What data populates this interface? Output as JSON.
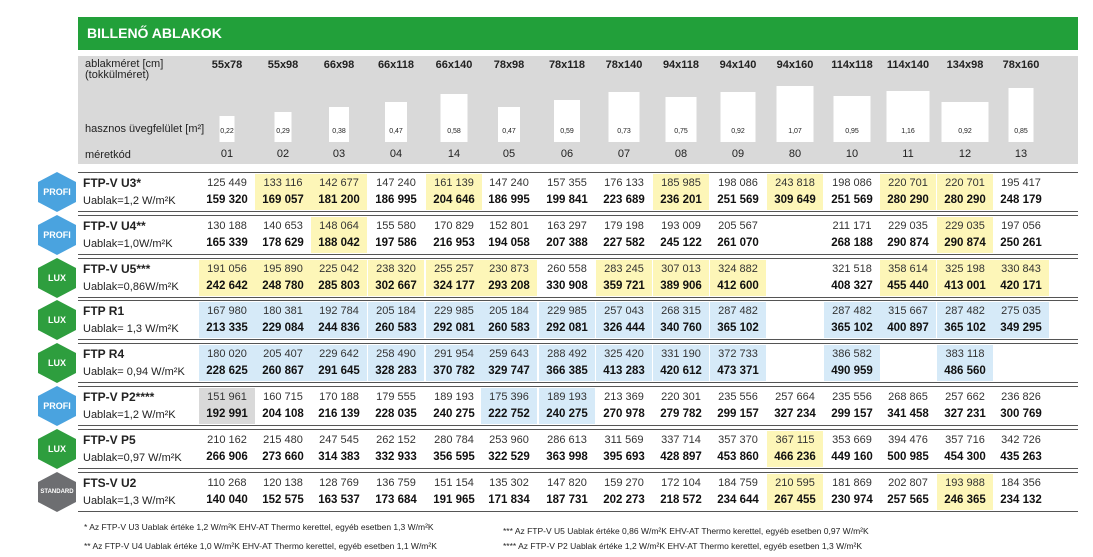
{
  "title": "BILLENŐ ABLAKOK",
  "header": {
    "size_label": "ablakméret [cm]\n(tokkülméret)",
    "area_label": "hasznos üvegfelület [m²]",
    "code_label": "méretkód",
    "columns": [
      {
        "size": "55x78",
        "area": "0,22",
        "code": "01"
      },
      {
        "size": "55x98",
        "area": "0,29",
        "code": "02"
      },
      {
        "size": "66x98",
        "area": "0,38",
        "code": "03"
      },
      {
        "size": "66x118",
        "area": "0,47",
        "code": "04"
      },
      {
        "size": "66x140",
        "area": "0,58",
        "code": "14"
      },
      {
        "size": "78x98",
        "area": "0,47",
        "code": "05"
      },
      {
        "size": "78x118",
        "area": "0,59",
        "code": "06"
      },
      {
        "size": "78x140",
        "area": "0,73",
        "code": "07"
      },
      {
        "size": "94x118",
        "area": "0,75",
        "code": "08"
      },
      {
        "size": "94x140",
        "area": "0,92",
        "code": "09"
      },
      {
        "size": "94x160",
        "area": "1,07",
        "code": "80"
      },
      {
        "size": "114x118",
        "area": "0,95",
        "code": "10"
      },
      {
        "size": "114x140",
        "area": "1,16",
        "code": "11"
      },
      {
        "size": "134x98",
        "area": "0,92",
        "code": "12"
      },
      {
        "size": "78x160",
        "area": "0,85",
        "code": "13"
      }
    ]
  },
  "rows": [
    {
      "badge": "PROFI",
      "badge_color": "#4aa3df",
      "name": "FTP-V U3*",
      "u": "Uablak=1,2 W/m²K",
      "p1": [
        "125 449",
        "133 116",
        "142 677",
        "147 240",
        "161 139",
        "147 240",
        "157 355",
        "176 133",
        "185 985",
        "198 086",
        "243 818",
        "198 086",
        "220 701",
        "220 701",
        "195 417"
      ],
      "p2": [
        "159 320",
        "169 057",
        "181 200",
        "186 995",
        "204 646",
        "186 995",
        "199 841",
        "223 689",
        "236 201",
        "251 569",
        "309 649",
        "251 569",
        "280 290",
        "280 290",
        "248 179"
      ]
    },
    {
      "badge": "PROFI",
      "badge_color": "#4aa3df",
      "name": "FTP-V U4**",
      "u": "Uablak=1,0W/m²K",
      "p1": [
        "130 188",
        "140 653",
        "148 064",
        "155 580",
        "170 829",
        "152 801",
        "163 297",
        "179 198",
        "193 009",
        "205 567",
        "",
        "211 171",
        "229 035",
        "229 035",
        "197 056"
      ],
      "p2": [
        "165 339",
        "178 629",
        "188 042",
        "197 586",
        "216 953",
        "194 058",
        "207 388",
        "227 582",
        "245 122",
        "261 070",
        "",
        "268 188",
        "290 874",
        "290 874",
        "250 261"
      ]
    },
    {
      "badge": "LUX",
      "badge_color": "#2e9e3e",
      "name": "FTP-V U5***",
      "u": "Uablak=0,86W/m²K",
      "p1": [
        "191 056",
        "195 890",
        "225 042",
        "238 320",
        "255 257",
        "230 873",
        "260 558",
        "283 245",
        "307 013",
        "324 882",
        "",
        "321 518",
        "358 614",
        "325 198",
        "330 843"
      ],
      "p2": [
        "242 642",
        "248 780",
        "285 803",
        "302 667",
        "324 177",
        "293 208",
        "330 908",
        "359 721",
        "389 906",
        "412 600",
        "",
        "408 327",
        "455 440",
        "413 001",
        "420 171"
      ]
    },
    {
      "badge": "LUX",
      "badge_color": "#2e9e3e",
      "name": "FTP R1",
      "u": "Uablak= 1,3 W/m²K",
      "p1": [
        "167 980",
        "180 381",
        "192 784",
        "205 184",
        "229 985",
        "205 184",
        "229 985",
        "257 043",
        "268 315",
        "287 482",
        "",
        "287 482",
        "315 667",
        "287 482",
        "275 035"
      ],
      "p2": [
        "213 335",
        "229 084",
        "244 836",
        "260 583",
        "292 081",
        "260 583",
        "292 081",
        "326 444",
        "340 760",
        "365 102",
        "",
        "365 102",
        "400 897",
        "365 102",
        "349 295"
      ]
    },
    {
      "badge": "LUX",
      "badge_color": "#2e9e3e",
      "name": "FTP R4",
      "u": "Uablak= 0,94 W/m²K",
      "p1": [
        "180 020",
        "205 407",
        "229 642",
        "258 490",
        "291 954",
        "259 643",
        "288 492",
        "325 420",
        "331 190",
        "372 733",
        "",
        "386 582",
        "",
        "383 118",
        ""
      ],
      "p2": [
        "228 625",
        "260 867",
        "291 645",
        "328 283",
        "370 782",
        "329 747",
        "366 385",
        "413 283",
        "420 612",
        "473 371",
        "",
        "490 959",
        "",
        "486 560",
        ""
      ]
    },
    {
      "badge": "PROFI",
      "badge_color": "#4aa3df",
      "name": "FTP-V P2****",
      "u": "Uablak=1,2 W/m²K",
      "p1": [
        "151 961",
        "160 715",
        "170 188",
        "179 555",
        "189 193",
        "175 396",
        "189 193",
        "213 369",
        "220 301",
        "235 556",
        "257 664",
        "235 556",
        "268 865",
        "257 662",
        "236 826"
      ],
      "p2": [
        "192 991",
        "204 108",
        "216 139",
        "228 035",
        "240 275",
        "222 752",
        "240 275",
        "270 978",
        "279 782",
        "299 157",
        "327 234",
        "299 157",
        "341 458",
        "327 231",
        "300 769"
      ]
    },
    {
      "badge": "LUX",
      "badge_color": "#2e9e3e",
      "name": "FTP-V P5",
      "u": "Uablak=0,97 W/m²K",
      "p1": [
        "210 162",
        "215 480",
        "247 545",
        "262 152",
        "280 784",
        "253 960",
        "286 613",
        "311 569",
        "337 714",
        "357 370",
        "367 115",
        "353 669",
        "394 476",
        "357 716",
        "342 726"
      ],
      "p2": [
        "266 906",
        "273 660",
        "314 383",
        "332 933",
        "356 595",
        "322 529",
        "363 998",
        "395 693",
        "428 897",
        "453 860",
        "466 236",
        "449 160",
        "500 985",
        "454 300",
        "435 263"
      ]
    },
    {
      "badge": "STANDARD",
      "badge_color": "#6d6e71",
      "name": "FTS-V U2",
      "u": "Uablak=1,3 W/m²K",
      "p1": [
        "110 268",
        "120 138",
        "128 769",
        "136 759",
        "151 154",
        "135 302",
        "147 820",
        "159 270",
        "172 104",
        "184 759",
        "210 595",
        "181 869",
        "202 807",
        "193 988",
        "184 356"
      ],
      "p2": [
        "140 040",
        "152 575",
        "163 537",
        "173 684",
        "191 965",
        "171 834",
        "187 731",
        "202 273",
        "218 572",
        "234 644",
        "267 455",
        "230 974",
        "257 565",
        "246 365",
        "234 132"
      ]
    }
  ],
  "footnotes": [
    "* Az FTP-V U3 Uablak értéke 1,2 W/m²K EHV-AT Thermo kerettel, egyéb esetben 1,3 W/m²K",
    "** Az FTP-V U4 Uablak értéke 1,0 W/m²K EHV-AT Thermo kerettel, egyéb esetben 1,1 W/m²K",
    "*** Az FTP-V U5 Uablak értéke 0,86 W/m²K EHV-AT Thermo kerettel, egyéb esetben 0,97 W/m²K",
    "**** Az FTP-V P2 Uablak értéke 1,2 W/m²K EHV-AT Thermo kerettel, egyéb esetben 1,3 W/m²K"
  ],
  "colors": {
    "green": "#22a03a",
    "yellow": "#fdf6b8",
    "blue": "#d6eaf8",
    "grey": "#d9d9d9"
  }
}
